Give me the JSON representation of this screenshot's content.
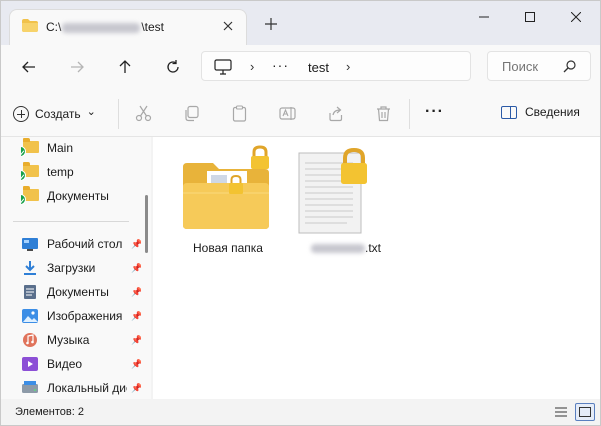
{
  "window": {
    "tab_title_prefix": "C:\\",
    "tab_title_suffix": "\\test"
  },
  "address": {
    "crumb_dots": "···",
    "crumb": "test"
  },
  "search": {
    "placeholder": "Поиск"
  },
  "commandbar": {
    "create_label": "Создать",
    "create_chevron": "⌄",
    "more": "···",
    "details_label": "Сведения"
  },
  "sidebar": {
    "synced": [
      {
        "label": "Main"
      },
      {
        "label": "temp"
      },
      {
        "label": "Документы"
      }
    ],
    "quick_access": [
      {
        "label": "Рабочий стол",
        "icon": "desktop-icon"
      },
      {
        "label": "Загрузки",
        "icon": "downloads-icon"
      },
      {
        "label": "Документы",
        "icon": "documents-icon"
      },
      {
        "label": "Изображения",
        "icon": "pictures-icon"
      },
      {
        "label": "Музыка",
        "icon": "music-icon"
      },
      {
        "label": "Видео",
        "icon": "videos-icon"
      },
      {
        "label": "Локальный диск",
        "icon": "drive-icon"
      }
    ]
  },
  "files": [
    {
      "name": "Новая папка",
      "type": "folder",
      "locked": true
    },
    {
      "name_suffix": ".txt",
      "type": "text",
      "locked": true
    }
  ],
  "statusbar": {
    "count": "Элементов: 2"
  },
  "colors": {
    "accent": "#2b5aa7",
    "folder": "#f1c24b",
    "lock": "#f3c331",
    "sync_ok": "#17a14a"
  }
}
